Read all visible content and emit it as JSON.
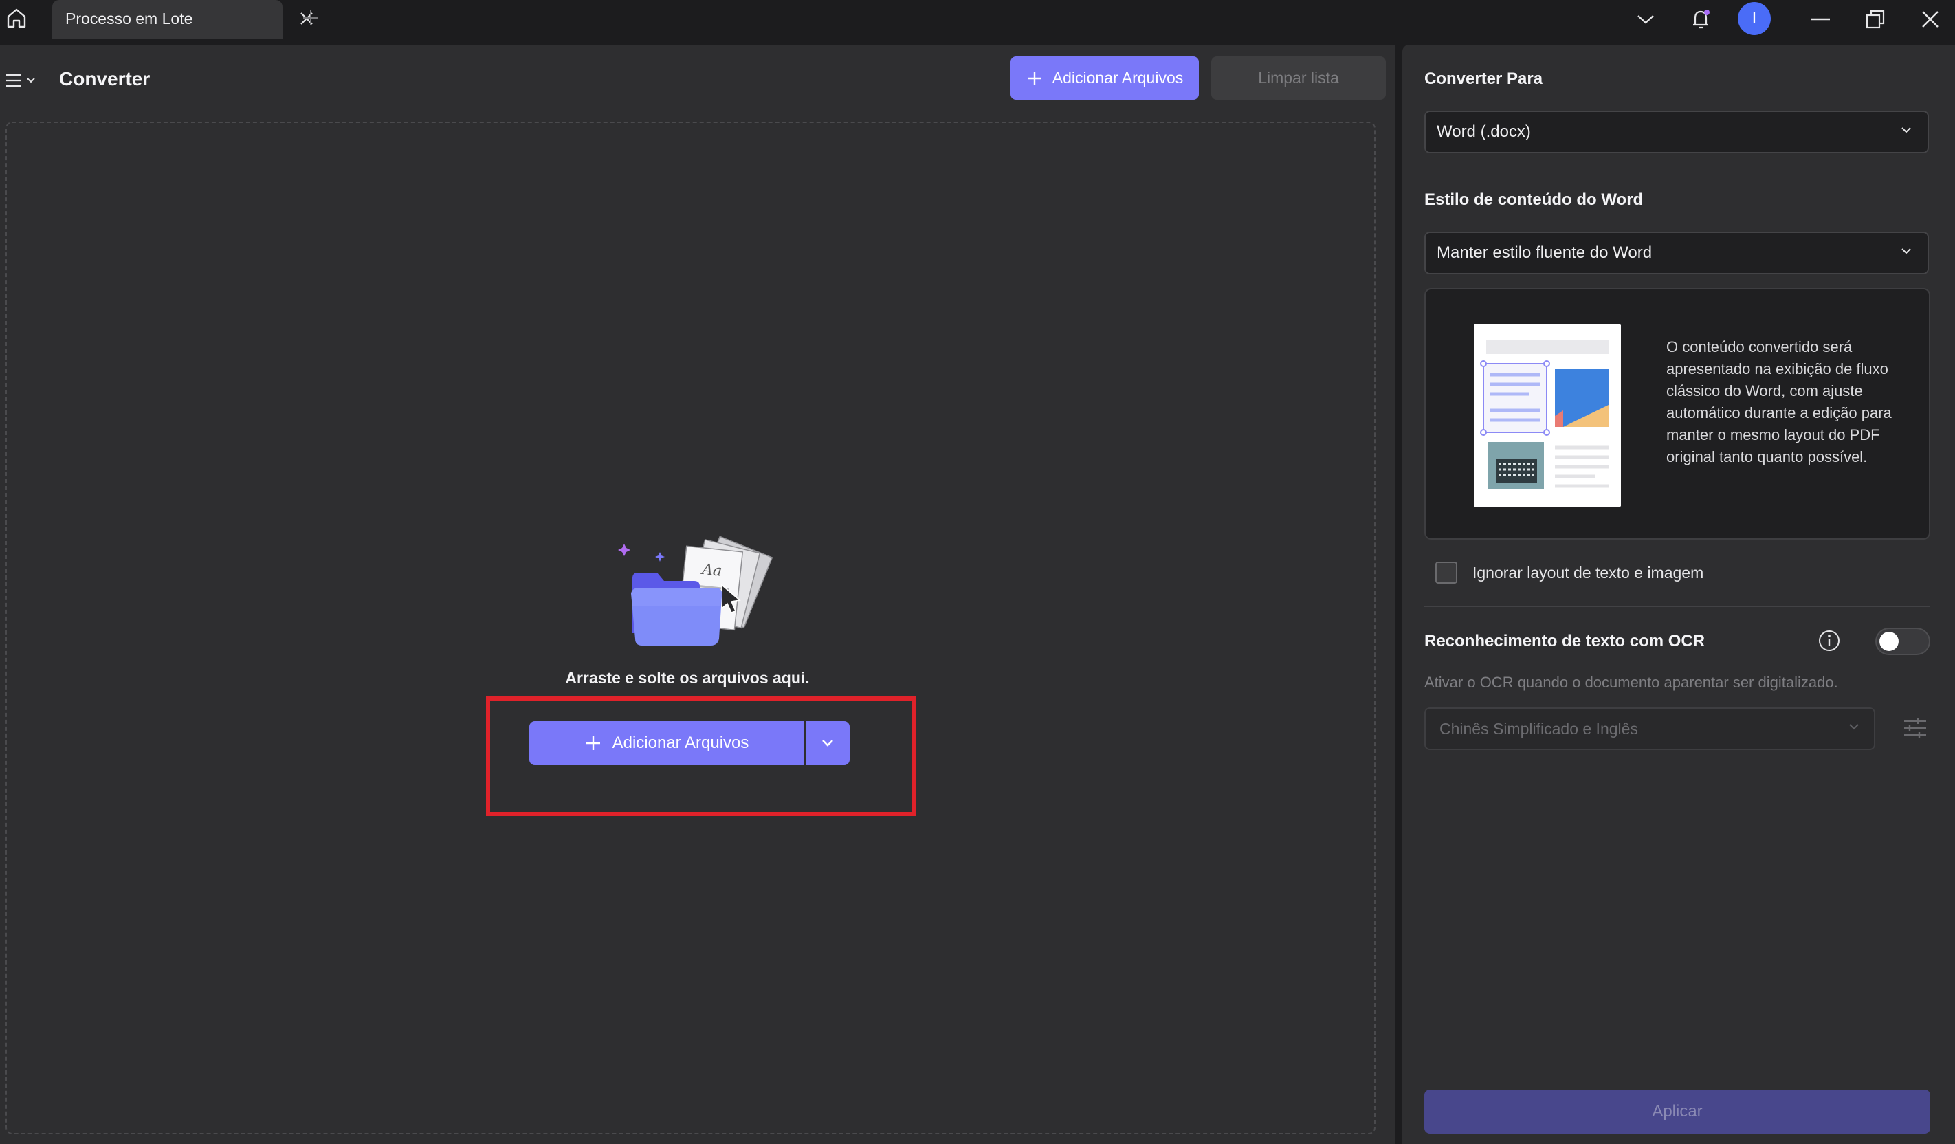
{
  "tab": {
    "label": "Processo em Lote"
  },
  "user": {
    "initial": "I"
  },
  "header": {
    "title": "Converter",
    "add_files_label": "Adicionar Arquivos",
    "clear_list_label": "Limpar lista"
  },
  "dropzone": {
    "text": "Arraste e solte os arquivos aqui.",
    "add_files_label": "Adicionar Arquivos"
  },
  "panel": {
    "convert_to_label": "Converter Para",
    "convert_to_value": "Word (.docx)",
    "word_style_label": "Estilo de conteúdo do Word",
    "word_style_value": "Manter estilo fluente do Word",
    "preview_description": "O conteúdo convertido será apresentado na exibição de fluxo clássico do Word, com ajuste automático durante a edição para manter o mesmo layout do PDF original tanto quanto possível.",
    "ignore_layout_label": "Ignorar layout de texto e imagem",
    "ignore_layout_checked": false,
    "ocr_label": "Reconhecimento de texto com OCR",
    "ocr_enabled": false,
    "ocr_description": "Ativar o OCR quando o documento aparentar ser digitalizado.",
    "ocr_language_value": "Chinês Simplificado e Inglês",
    "apply_label": "Aplicar"
  },
  "colors": {
    "accent": "#7a78f9",
    "highlight_border": "#e0222a",
    "avatar": "#4a6cf7"
  }
}
